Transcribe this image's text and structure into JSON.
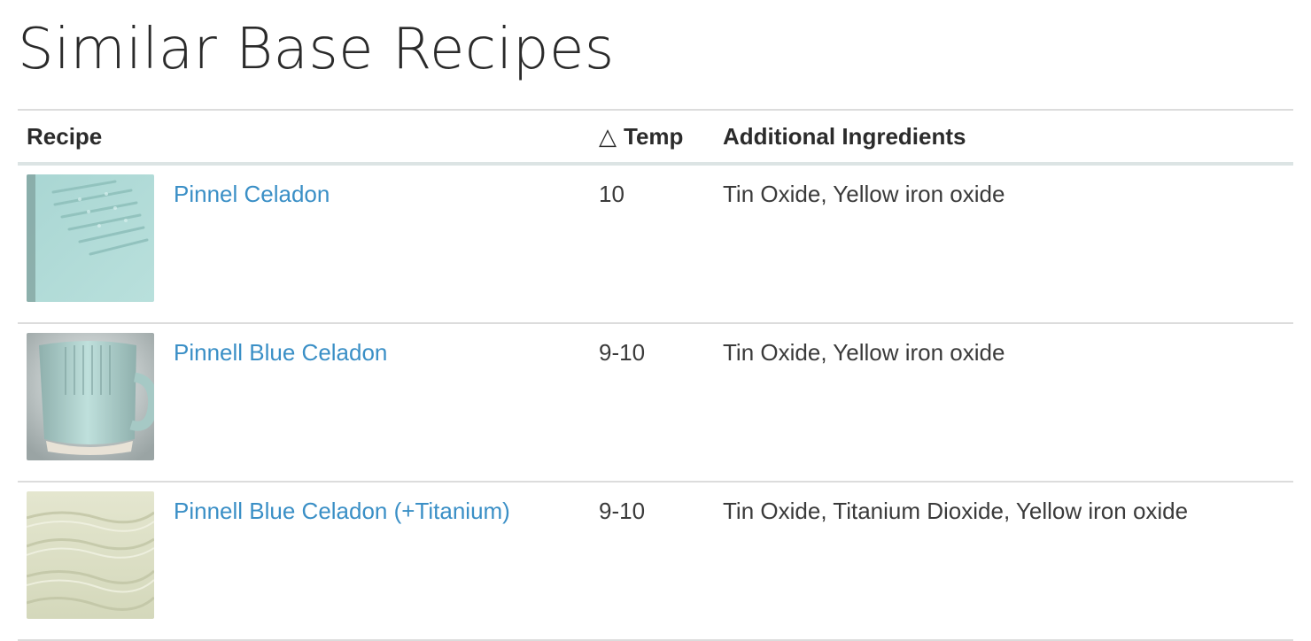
{
  "page": {
    "title": "Similar Base Recipes"
  },
  "table": {
    "headers": {
      "recipe": "Recipe",
      "temp_symbol": "△",
      "temp": "Temp",
      "ingredients": "Additional Ingredients"
    },
    "rows": [
      {
        "name": "Pinnel Celadon",
        "temp": "10",
        "ingredients": "Tin Oxide, Yellow iron oxide",
        "thumb": "celadon-tile-thumbnail"
      },
      {
        "name": "Pinnell Blue Celadon",
        "temp": "9-10",
        "ingredients": "Tin Oxide, Yellow iron oxide",
        "thumb": "celadon-mug-thumbnail"
      },
      {
        "name": "Pinnell Blue Celadon (+Titanium)",
        "temp": "9-10",
        "ingredients": "Tin Oxide, Titanium Dioxide, Yellow iron oxide",
        "thumb": "cream-tile-thumbnail"
      }
    ]
  },
  "colors": {
    "link": "#3a8fc6",
    "text": "#2b2b2b",
    "rule": "#dcdcdc"
  }
}
